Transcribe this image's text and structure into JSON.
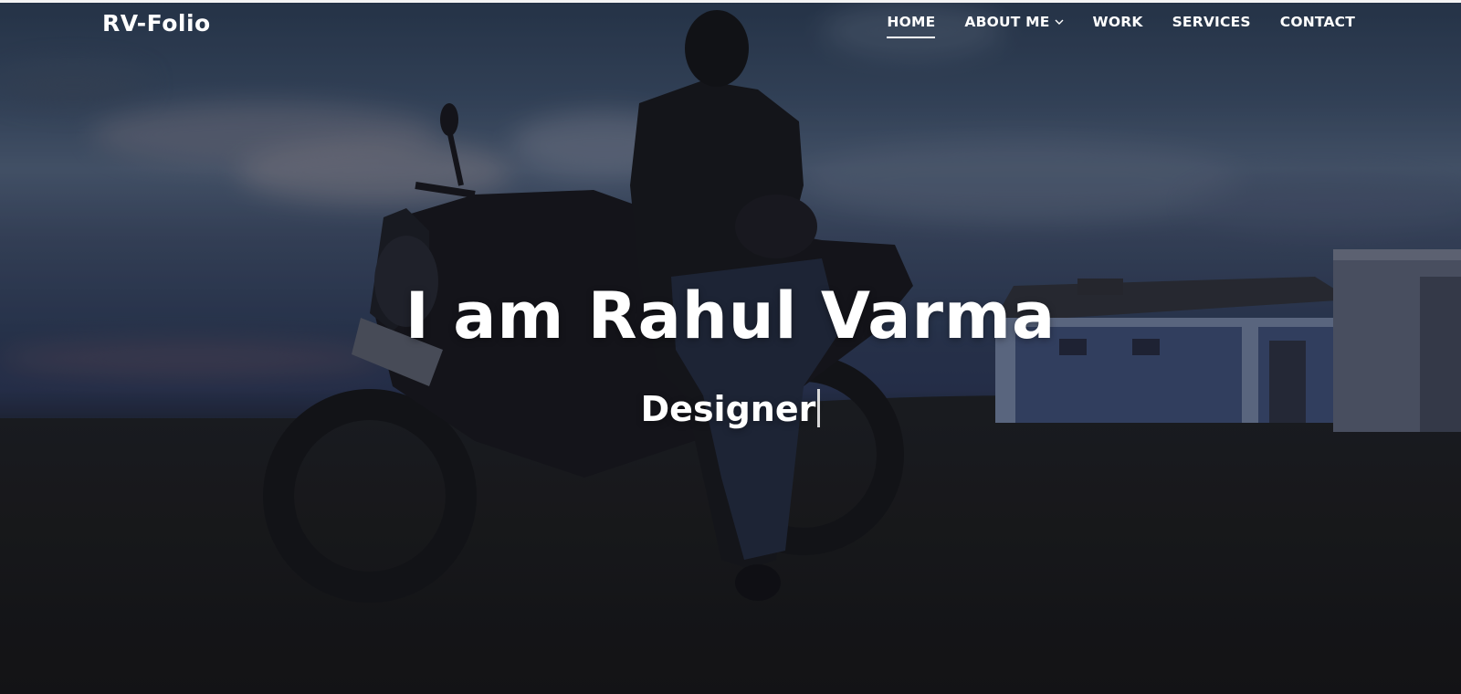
{
  "brand": {
    "name": "RV-Folio"
  },
  "nav": {
    "items": [
      {
        "label": "HOME",
        "active": true
      },
      {
        "label": "ABOUT ME",
        "has_dropdown": true,
        "icon": "chevron-down-icon"
      },
      {
        "label": "WORK"
      },
      {
        "label": "SERVICES"
      },
      {
        "label": "CONTACT"
      }
    ]
  },
  "hero": {
    "headline": "I am Rahul Varma",
    "typed_text": "Designer",
    "text_color": "#ffffff"
  }
}
